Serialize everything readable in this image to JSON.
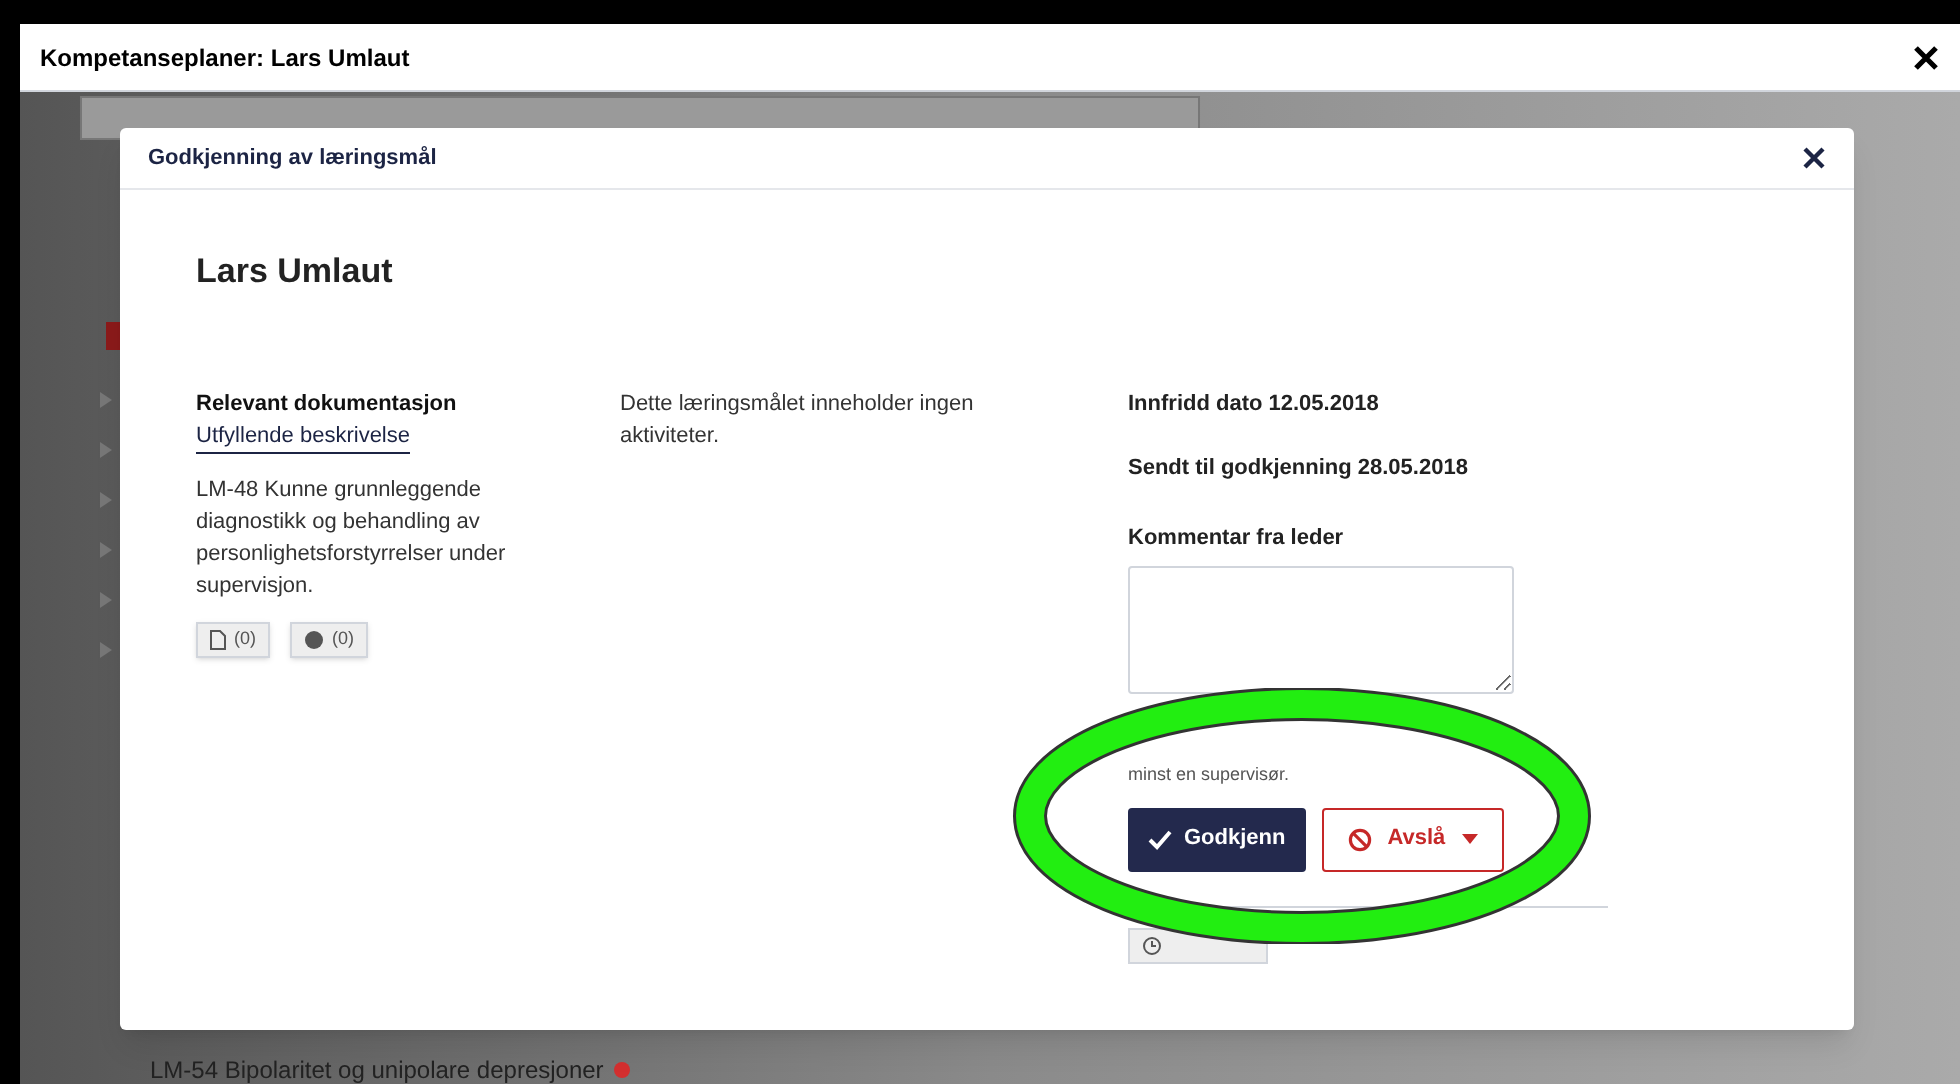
{
  "window": {
    "title": "Kompetanseplaner: Lars Umlaut"
  },
  "background": {
    "list_item": {
      "label": "LM-54 Bipolaritet og unipolare depresjoner",
      "color": "#d32f2f"
    }
  },
  "dialog": {
    "title": "Godkjenning av læringsmål",
    "person": "Lars Umlaut",
    "documentation": {
      "heading": "Relevant dokumentasjon",
      "link": "Utfyllende beskrivelse",
      "description": "LM-48 Kunne grunnleggende diagnostikk og behandling av personlighetsforstyrrelser under supervisjon.",
      "attachments": [
        {
          "kind": "document",
          "count": "(0)"
        },
        {
          "kind": "comment",
          "count": "(0)"
        }
      ]
    },
    "activities_note": "Dette læringsmålet inneholder ingen aktiviteter.",
    "fulfilled": "Innfridd dato 12.05.2018",
    "sent": "Sendt til godkjenning 28.05.2018",
    "comment_label": "Kommentar fra leder",
    "supervisor_note": "minst en supervisør.",
    "buttons": [
      {
        "kind": "approve",
        "label": "Godkjenn"
      },
      {
        "kind": "reject",
        "label": "Avslå"
      }
    ]
  }
}
